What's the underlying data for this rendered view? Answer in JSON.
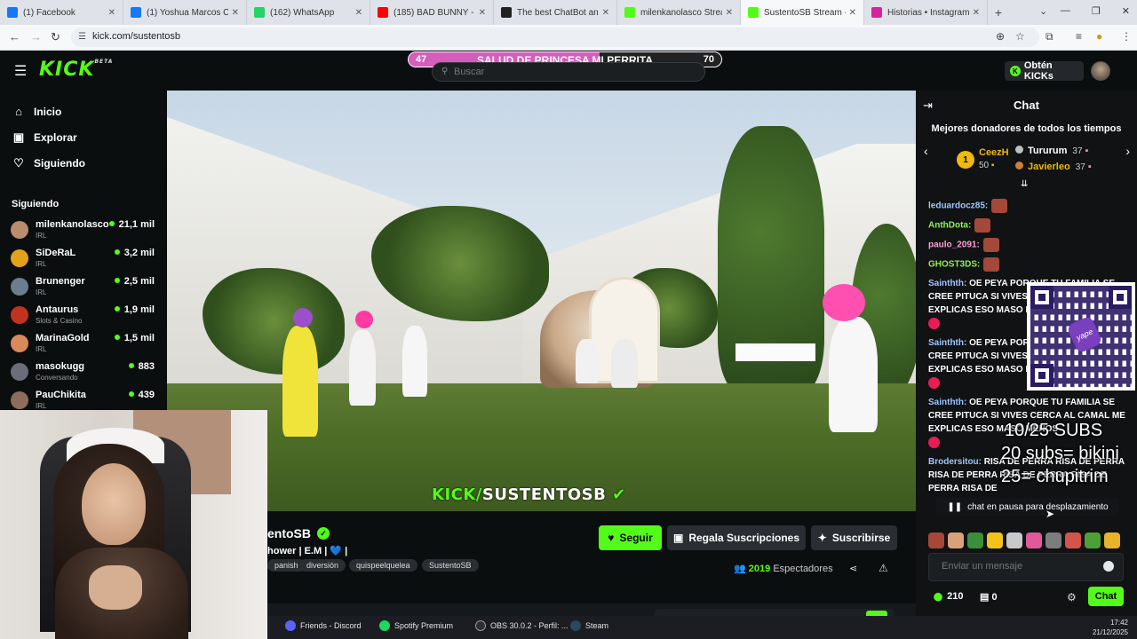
{
  "browser": {
    "tabs": [
      {
        "title": "(1) Facebook",
        "color": "#1877f2",
        "icon": "facebook-icon"
      },
      {
        "title": "(1) Yoshua Marcos CA | Fa",
        "color": "#1877f2",
        "icon": "facebook-icon"
      },
      {
        "title": "(162) WhatsApp",
        "color": "#25d366",
        "icon": "whatsapp-icon"
      },
      {
        "title": "(185) BAD BUNNY - CALL",
        "color": "#ff0000",
        "icon": "youtube-icon"
      },
      {
        "title": "The best ChatBot and Wi",
        "color": "#222222",
        "icon": "chatbot-icon"
      },
      {
        "title": "milenkanolasco Stream -",
        "color": "#53fc18",
        "icon": "kick-icon"
      },
      {
        "title": "SustentoSB Stream -",
        "color": "#53fc18",
        "icon": "kick-icon"
      },
      {
        "title": "Historias • Instagram",
        "color": "#d6249f",
        "icon": "instagram-icon"
      }
    ],
    "url": "kick.com/sustentosb"
  },
  "header": {
    "logo": "KICK",
    "logo_badge": "BETA",
    "goal": {
      "left": "47",
      "text": "SALUD DE PRINCESA MI PERRITA",
      "right": "70",
      "progress": 0.61
    },
    "search_placeholder": "Buscar",
    "get_kicks": "Obtén KICKs"
  },
  "sidebar": {
    "nav": [
      {
        "label": "Inicio",
        "icon": "home-icon",
        "glyph": "⌂"
      },
      {
        "label": "Explorar",
        "icon": "compass-icon",
        "glyph": "▣"
      },
      {
        "label": "Siguiendo",
        "icon": "heart-icon",
        "glyph": "♡"
      }
    ],
    "following_title": "Siguiendo",
    "channels": [
      {
        "name": "milenkanolasco",
        "category": "IRL",
        "viewers": "21,1 mil",
        "color": "#b98c6e"
      },
      {
        "name": "SiDeRaL",
        "category": "IRL",
        "viewers": "3,2 mil",
        "color": "#e2a21a"
      },
      {
        "name": "Brunenger",
        "category": "IRL",
        "viewers": "2,5 mil",
        "color": "#6b7d8f"
      },
      {
        "name": "Antaurus",
        "category": "Slots & Casino",
        "viewers": "1,9 mil",
        "color": "#c2331f"
      },
      {
        "name": "MarinaGold",
        "category": "IRL",
        "viewers": "1,5 mil",
        "color": "#d88a5a"
      },
      {
        "name": "masokugg",
        "category": "Conversando",
        "viewers": "883",
        "color": "#6d6d7a"
      },
      {
        "name": "PauChikita",
        "category": "IRL",
        "viewers": "439",
        "color": "#8e6c5a"
      }
    ]
  },
  "video": {
    "watermark_kick": "KICK/",
    "watermark_name": "SUSTENTOSB"
  },
  "stream": {
    "name": "entoSB",
    "title": "hower | E.M | 💙 |",
    "tags": [
      "panish",
      "diversión",
      "quispeelquelea",
      "SustentoSB"
    ],
    "follow": "Seguir",
    "gift_subs": "Regala Suscripciones",
    "subscribe": "Suscribirse",
    "viewers_count": "2019",
    "viewers_label": "Espectadores"
  },
  "taskbar": {
    "items": [
      {
        "label": "Friends - Discord",
        "color": "#5865f2"
      },
      {
        "label": "Spotify Premium",
        "color": "#1ed760"
      },
      {
        "label": "OBS 30.0.2 - Perfil: ...",
        "color": "#302e31"
      },
      {
        "label": "Steam",
        "color": "#1b2838"
      }
    ],
    "time": "17:42",
    "date": "21/12/2025"
  },
  "chat": {
    "title": "Chat",
    "donors_title": "Mejores donadores de todos los tiempos",
    "top_donor": {
      "rank": "1",
      "name": "CeezH",
      "amount": "50"
    },
    "donors": [
      {
        "name": "Tururum",
        "amount": "37",
        "color": "#ffffff"
      },
      {
        "name": "Javierleo",
        "amount": "37",
        "color": "#f0b90b"
      }
    ],
    "messages": [
      {
        "user": "leduardocz85:",
        "text": "",
        "cls": "blue"
      },
      {
        "user": "AnthDota:",
        "text": "",
        "cls": "green"
      },
      {
        "user": "paulo_2091:",
        "text": "",
        "cls": "pink"
      },
      {
        "user": "GHOST3DS:",
        "text": "",
        "cls": "green"
      },
      {
        "user": "Sainthth:",
        "text": "OE PEYA PORQUE TU FAMILIA SE CREE PITUCA SI VIVES CERCA AL CAMAL ME EXPLICAS ESO MASO MENOS",
        "cls": "blue"
      },
      {
        "user": "Sainthth:",
        "text": "OE PEYA PORQUE TU FAMILIA SE CREE PITUCA SI VIVES CERCA AL CAMAL ME EXPLICAS ESO MASO MENOS",
        "cls": "blue"
      },
      {
        "user": "Sainthth:",
        "text": "OE PEYA PORQUE TU FAMILIA SE CREE PITUCA SI VIVES CERCA AL CAMAL ME EXPLICAS ESO MASO MENOS",
        "cls": "blue"
      },
      {
        "user": "Brodersitou:",
        "text": "RISA DE PERRA RISA DE PERRA RISA DE PERRA RISA DE PERRA RISA DE PERRA RISA DE",
        "cls": "blue"
      }
    ],
    "qr_logo": "yape",
    "sub_goal_lines": [
      "10/25 SUBS",
      "20 subs= bikini",
      "25= chupitrim"
    ],
    "paused_notice": "chat en pausa para desplazamiento",
    "input_placeholder": "Enviar un mensaje",
    "kicks": "210",
    "store": "0",
    "send": "Chat"
  }
}
